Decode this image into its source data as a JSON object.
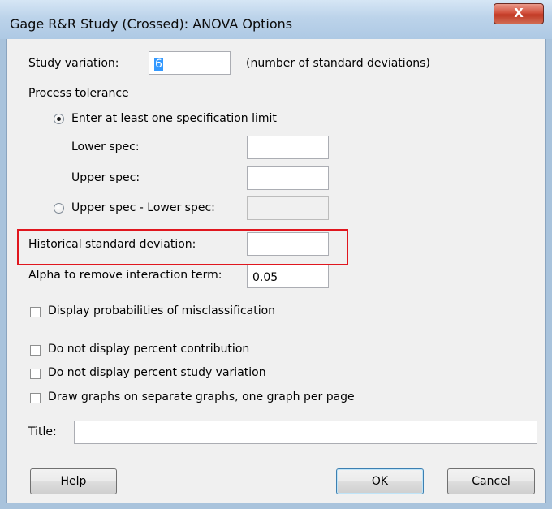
{
  "window": {
    "title": "Gage R&R Study (Crossed): ANOVA Options",
    "close_glyph": "X"
  },
  "study_variation": {
    "label": "Study variation:",
    "value": "6",
    "hint": "(number of standard deviations)"
  },
  "process_tolerance": {
    "heading": "Process tolerance",
    "option_spec_limit": "Enter at least one specification limit",
    "option_spec_limit_selected": true,
    "lower_spec_label": "Lower spec:",
    "lower_spec_value": "",
    "upper_spec_label": "Upper spec:",
    "upper_spec_value": "",
    "option_range": "Upper spec - Lower spec:",
    "option_range_selected": false,
    "range_value": ""
  },
  "historical_sd": {
    "label": "Historical standard deviation:",
    "value": ""
  },
  "alpha": {
    "label": "Alpha to remove interaction term:",
    "value": "0.05"
  },
  "checkboxes": [
    {
      "label": "Display probabilities of misclassification",
      "checked": false
    },
    {
      "label": "Do not display percent contribution",
      "checked": false
    },
    {
      "label": "Do not display percent study variation",
      "checked": false
    },
    {
      "label": "Draw graphs on separate graphs, one graph per page",
      "checked": false
    }
  ],
  "title_field": {
    "label": "Title:",
    "value": ""
  },
  "buttons": {
    "help": "Help",
    "ok": "OK",
    "cancel": "Cancel"
  },
  "colors": {
    "highlight_border": "#e0161e",
    "selection": "#3399ff",
    "close_button": "#c13a25"
  }
}
